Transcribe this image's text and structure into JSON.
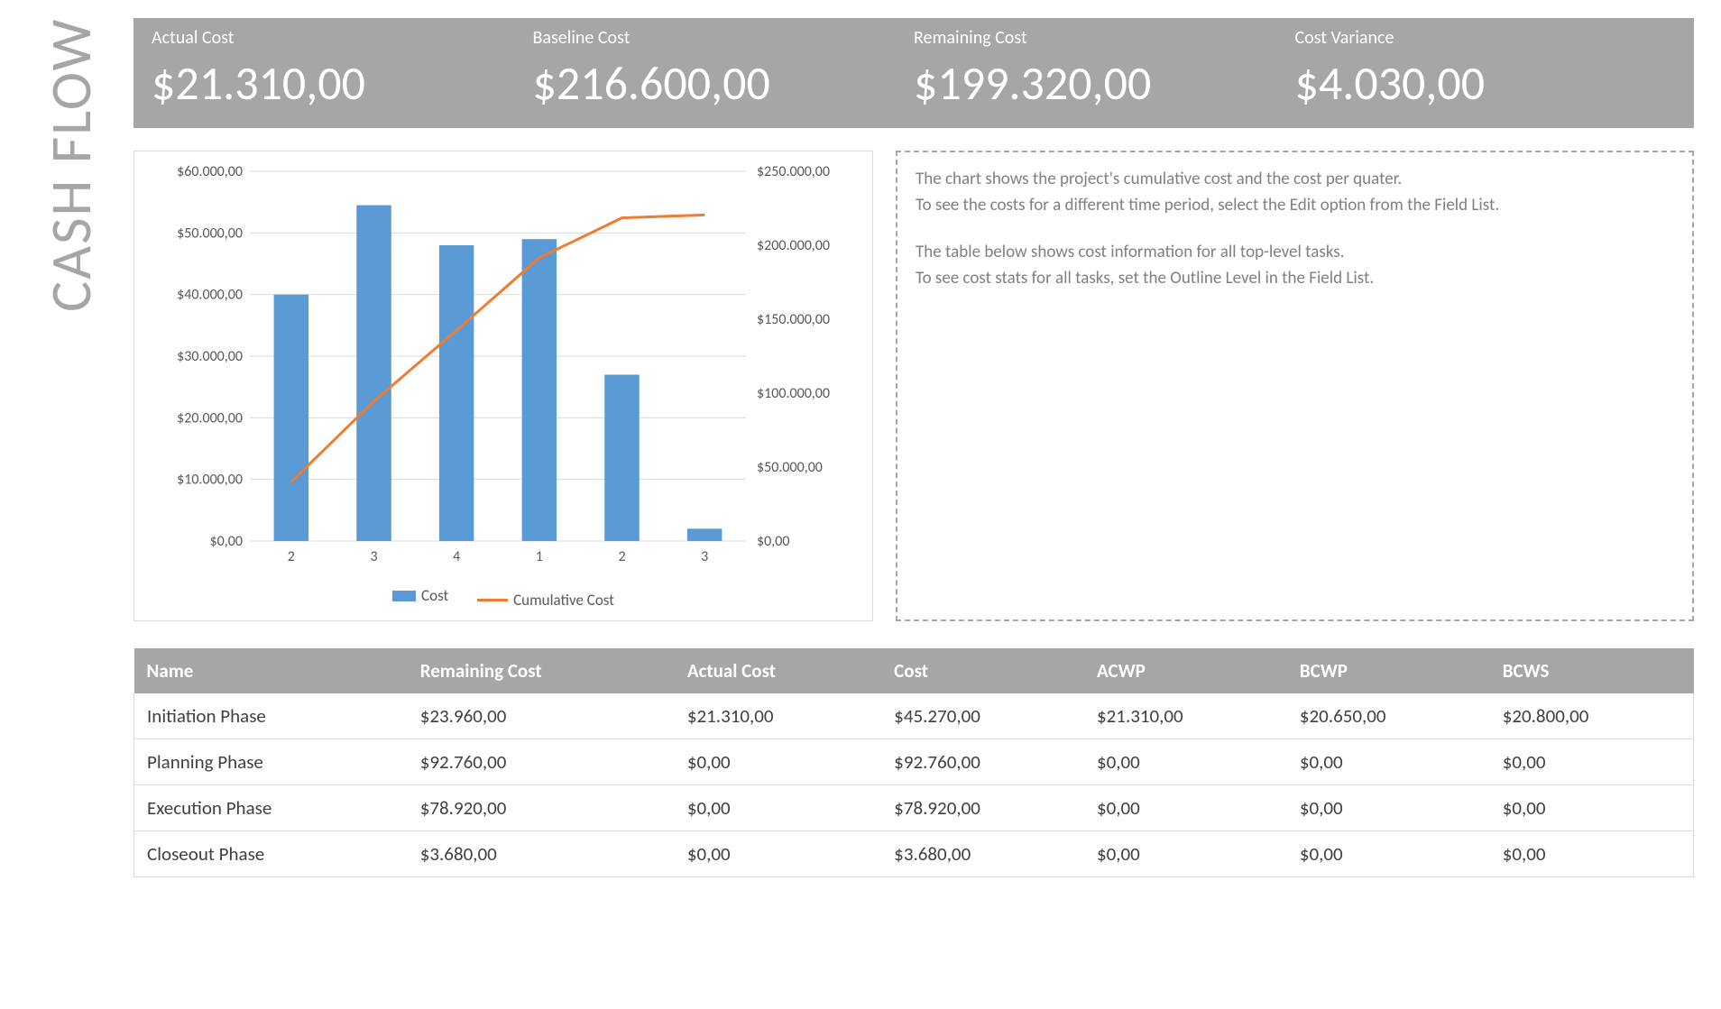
{
  "title": "CASH FLOW",
  "metrics": [
    {
      "label": "Actual Cost",
      "value": "$21.310,00"
    },
    {
      "label": "Baseline Cost",
      "value": "$216.600,00"
    },
    {
      "label": "Remaining Cost",
      "value": "$199.320,00"
    },
    {
      "label": "Cost Variance",
      "value": "$4.030,00"
    }
  ],
  "description": {
    "line1": "The chart shows the project's cumulative cost and the cost per quater.",
    "line2": "To see the costs for a different time period, select the Edit option from the Field List.",
    "line3": "The table below shows cost information for all top-level tasks.",
    "line4": "To see cost stats for all tasks, set the Outline Level in the Field List."
  },
  "chart_data": {
    "type": "bar",
    "categories": [
      "2",
      "3",
      "4",
      "1",
      "2",
      "3"
    ],
    "series": [
      {
        "name": "Cost",
        "type": "bar",
        "axis": "left",
        "values": [
          40000,
          54500,
          48000,
          49000,
          27000,
          2000
        ]
      },
      {
        "name": "Cumulative Cost",
        "type": "line",
        "axis": "right",
        "values": [
          40000,
          94500,
          142500,
          191500,
          218500,
          220500
        ]
      }
    ],
    "ylabel_left": "",
    "ylabel_right": "",
    "ylim_left": [
      0,
      60000
    ],
    "ylim_right": [
      0,
      250000
    ],
    "left_ticks": [
      "$0,00",
      "$10.000,00",
      "$20.000,00",
      "$30.000,00",
      "$40.000,00",
      "$50.000,00",
      "$60.000,00"
    ],
    "right_ticks": [
      "$0,00",
      "$50.000,00",
      "$100.000,00",
      "$150.000,00",
      "$200.000,00",
      "$250.000,00"
    ],
    "legend": {
      "cost": "Cost",
      "cumulative": "Cumulative Cost"
    }
  },
  "table": {
    "headers": [
      "Name",
      "Remaining Cost",
      "Actual Cost",
      "Cost",
      "ACWP",
      "BCWP",
      "BCWS"
    ],
    "rows": [
      [
        "Initiation Phase",
        "$23.960,00",
        "$21.310,00",
        "$45.270,00",
        "$21.310,00",
        "$20.650,00",
        "$20.800,00"
      ],
      [
        "Planning Phase",
        "$92.760,00",
        "$0,00",
        "$92.760,00",
        "$0,00",
        "$0,00",
        "$0,00"
      ],
      [
        "Execution Phase",
        "$78.920,00",
        "$0,00",
        "$78.920,00",
        "$0,00",
        "$0,00",
        "$0,00"
      ],
      [
        "Closeout Phase",
        "$3.680,00",
        "$0,00",
        "$3.680,00",
        "$0,00",
        "$0,00",
        "$0,00"
      ]
    ]
  }
}
